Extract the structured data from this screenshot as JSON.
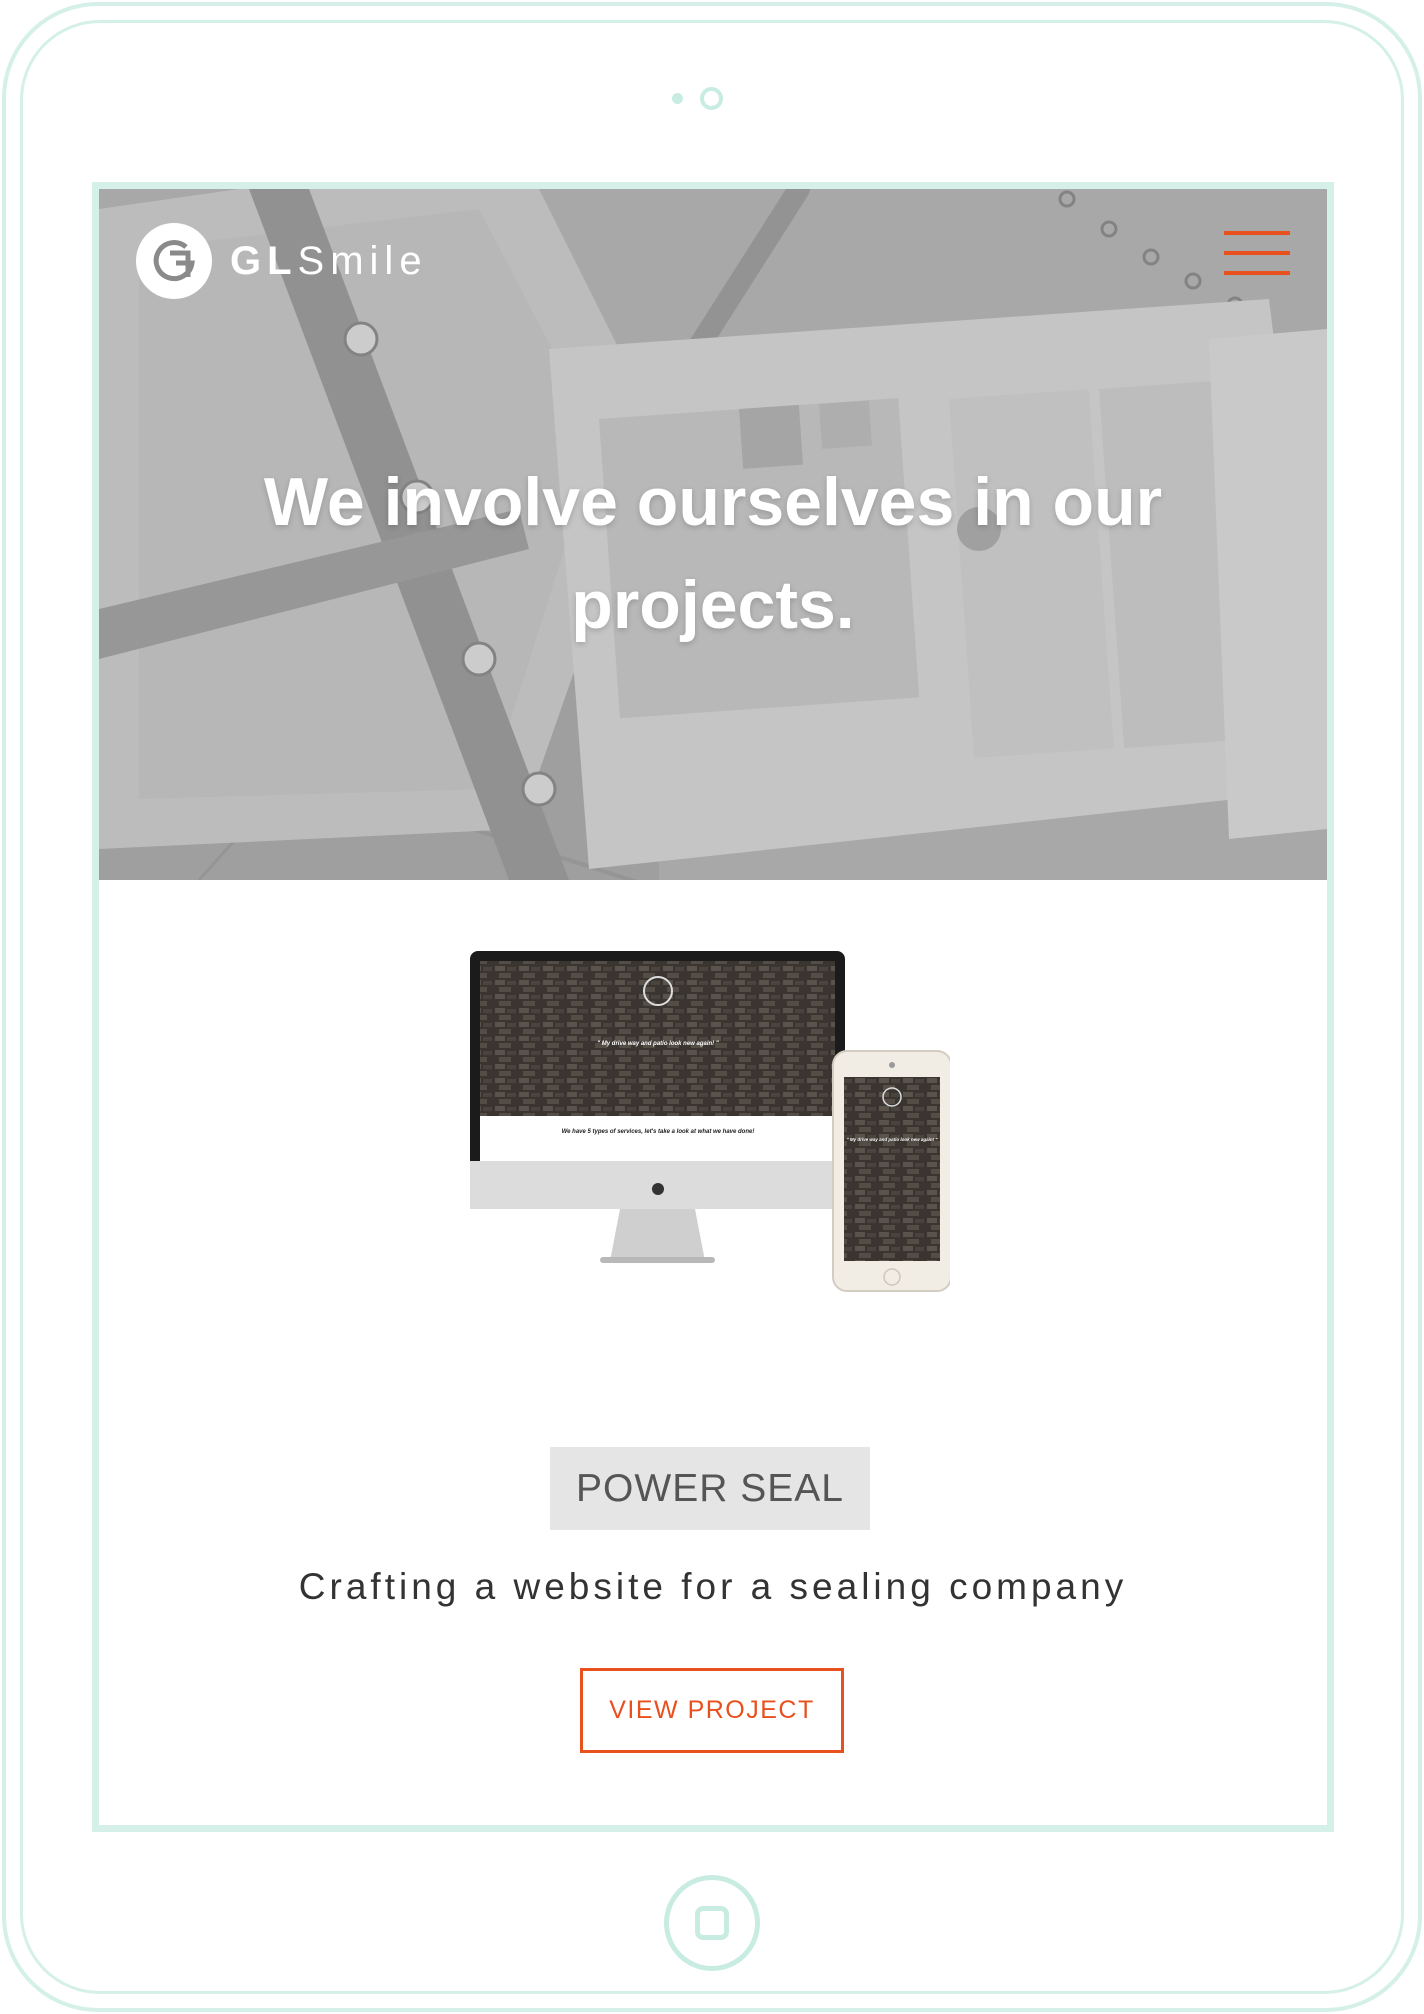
{
  "device": {
    "frame_color": "#d4f0e8"
  },
  "header": {
    "logo_initials": "G",
    "logo_gl": "GL",
    "logo_smile": "Smile",
    "menu_icon": "hamburger-menu-icon",
    "menu_color": "#e8501e"
  },
  "hero": {
    "title": "We involve ourselves in our projects."
  },
  "mockup": {
    "desktop_quote": "\" My drive way and patio look new again! \"",
    "desktop_banner": "We have 5 types of services, let's take a look at what we have done!",
    "phone_quote": "\" My drive way and patio look new again! \""
  },
  "project": {
    "name": "POWER SEAL",
    "description": "Crafting a website for a sealing company",
    "button_label": "VIEW PROJECT",
    "accent_color": "#e8501e"
  }
}
